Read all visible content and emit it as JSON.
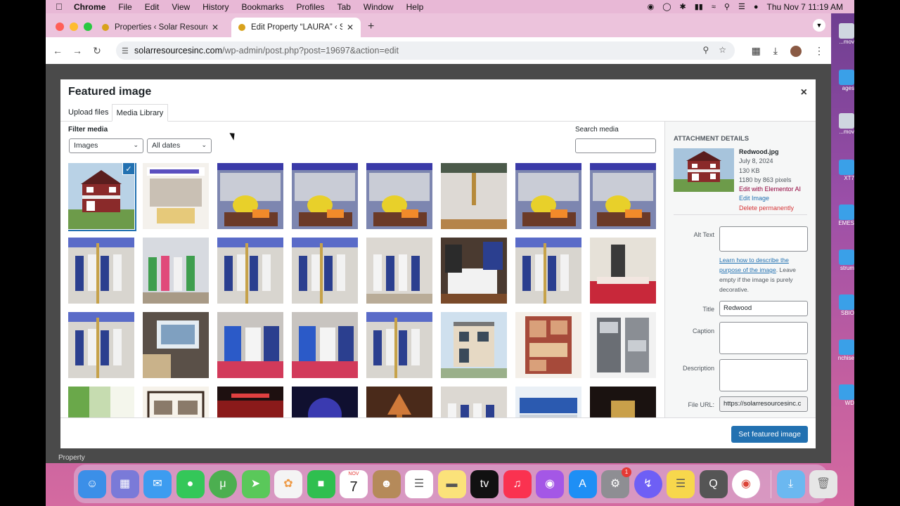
{
  "menubar": {
    "app": "Chrome",
    "items": [
      "File",
      "Edit",
      "View",
      "History",
      "Bookmarks",
      "Profiles",
      "Tab",
      "Window",
      "Help"
    ],
    "clock": "Thu Nov 7  11:19 AM"
  },
  "desktop_labels": [
    "...mov",
    "ages",
    "...mov",
    "XT7",
    "EMES",
    "strum",
    "SBIO",
    "nchise",
    "WD"
  ],
  "browser": {
    "tabs": [
      {
        "label": "Properties ‹ Solar Resources",
        "active": false
      },
      {
        "label": "Edit Property “LAURA” ‹ Solar",
        "active": true
      }
    ],
    "url_host": "solarresourcesinc.com",
    "url_path": "/wp-admin/post.php?post=19697&action=edit"
  },
  "page": {
    "footer_label": "Property"
  },
  "modal": {
    "title": "Featured image",
    "close_glyph": "×",
    "tabs": [
      "Upload files",
      "Media Library"
    ],
    "filter_label": "Filter media",
    "filter_type": "Images",
    "filter_date": "All dates",
    "search_label": "Search media",
    "search_value": "",
    "submit_label": "Set featured image"
  },
  "media_grid": [
    {
      "kind": "house-red",
      "selected": true
    },
    {
      "kind": "banner"
    },
    {
      "kind": "ceremony-yellow"
    },
    {
      "kind": "ceremony-yellow"
    },
    {
      "kind": "ceremony-yellow"
    },
    {
      "kind": "pole"
    },
    {
      "kind": "ceremony-yellow"
    },
    {
      "kind": "ceremony-yellow"
    },
    {
      "kind": "group-blue"
    },
    {
      "kind": "group-green"
    },
    {
      "kind": "group-blue"
    },
    {
      "kind": "group-blue"
    },
    {
      "kind": "group-white"
    },
    {
      "kind": "signing"
    },
    {
      "kind": "group-blue"
    },
    {
      "kind": "table-red"
    },
    {
      "kind": "group-blue"
    },
    {
      "kind": "poster"
    },
    {
      "kind": "crowd-blue"
    },
    {
      "kind": "crowd-blue"
    },
    {
      "kind": "group-blue"
    },
    {
      "kind": "house-beige"
    },
    {
      "kind": "floorplan-red"
    },
    {
      "kind": "floorplan-gray"
    },
    {
      "kind": "green-fade"
    },
    {
      "kind": "floorplan-frame"
    },
    {
      "kind": "stage-red"
    },
    {
      "kind": "stage-blue"
    },
    {
      "kind": "trophy"
    },
    {
      "kind": "group-white"
    },
    {
      "kind": "banner-ground"
    },
    {
      "kind": "award-dark"
    }
  ],
  "attachment": {
    "heading": "ATTACHMENT DETAILS",
    "filename": "Redwood.jpg",
    "date": "July 8, 2024",
    "size": "130 KB",
    "dimensions": "1180 by 863 pixels",
    "edit_elementor": "Edit with Elementor AI",
    "edit_image": "Edit Image",
    "delete": "Delete permanently",
    "alt_label": "Alt Text",
    "alt_value": "",
    "alt_help_link": "Learn how to describe the purpose of the image",
    "alt_help_rest": ". Leave empty if the image is purely decorative.",
    "title_label": "Title",
    "title_value": "Redwood",
    "caption_label": "Caption",
    "caption_value": "",
    "description_label": "Description",
    "description_value": "",
    "fileurl_label": "File URL:",
    "fileurl_value": "https://solarresourcesinc.c"
  },
  "dock": {
    "calendar_month": "NOV",
    "calendar_day": "7",
    "system_settings_badge": "1",
    "apps": [
      "Finder",
      "Launchpad",
      "Mail",
      "Messages",
      "uTorrent",
      "Maps",
      "Photos",
      "FaceTime",
      "Calendar",
      "Contacts",
      "Reminders",
      "Notes",
      "TV",
      "Music",
      "Podcasts",
      "App Store",
      "System Settings",
      "Messenger",
      "Stickies",
      "QuickTime",
      "Chrome",
      "Downloads",
      "Trash"
    ]
  },
  "colors": {
    "wp_blue": "#2271b1",
    "danger": "#d63638",
    "elementor": "#92003b"
  }
}
